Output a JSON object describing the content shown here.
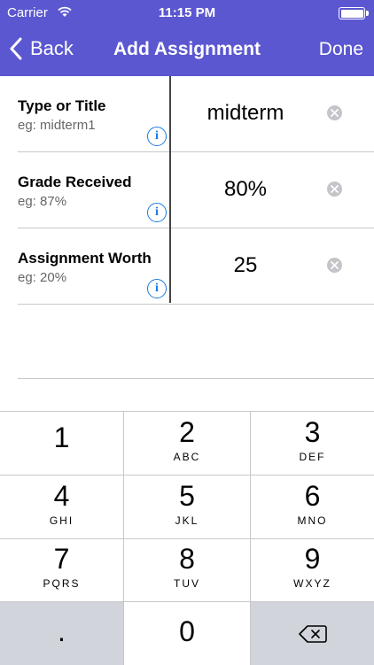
{
  "status_bar": {
    "carrier": "Carrier",
    "time": "11:15 PM"
  },
  "nav": {
    "back_label": "Back",
    "title": "Add Assignment",
    "done_label": "Done"
  },
  "fields": [
    {
      "label": "Type or Title",
      "hint": "eg: midterm1",
      "value": "midterm"
    },
    {
      "label": "Grade Received",
      "hint": "eg: 87%",
      "value": "80%"
    },
    {
      "label": "Assignment Worth",
      "hint": "eg: 20%",
      "value": "25"
    }
  ],
  "keypad": {
    "keys": [
      {
        "num": "1",
        "letters": ""
      },
      {
        "num": "2",
        "letters": "ABC"
      },
      {
        "num": "3",
        "letters": "DEF"
      },
      {
        "num": "4",
        "letters": "GHI"
      },
      {
        "num": "5",
        "letters": "JKL"
      },
      {
        "num": "6",
        "letters": "MNO"
      },
      {
        "num": "7",
        "letters": "PQRS"
      },
      {
        "num": "8",
        "letters": "TUV"
      },
      {
        "num": "9",
        "letters": "WXYZ"
      },
      {
        "num": ".",
        "letters": ""
      },
      {
        "num": "0",
        "letters": ""
      }
    ],
    "delete_icon": "backspace-icon"
  },
  "colors": {
    "nav_bg": "#5b57d0",
    "info_blue": "#1a7be0",
    "key_gray": "#d1d4da"
  }
}
